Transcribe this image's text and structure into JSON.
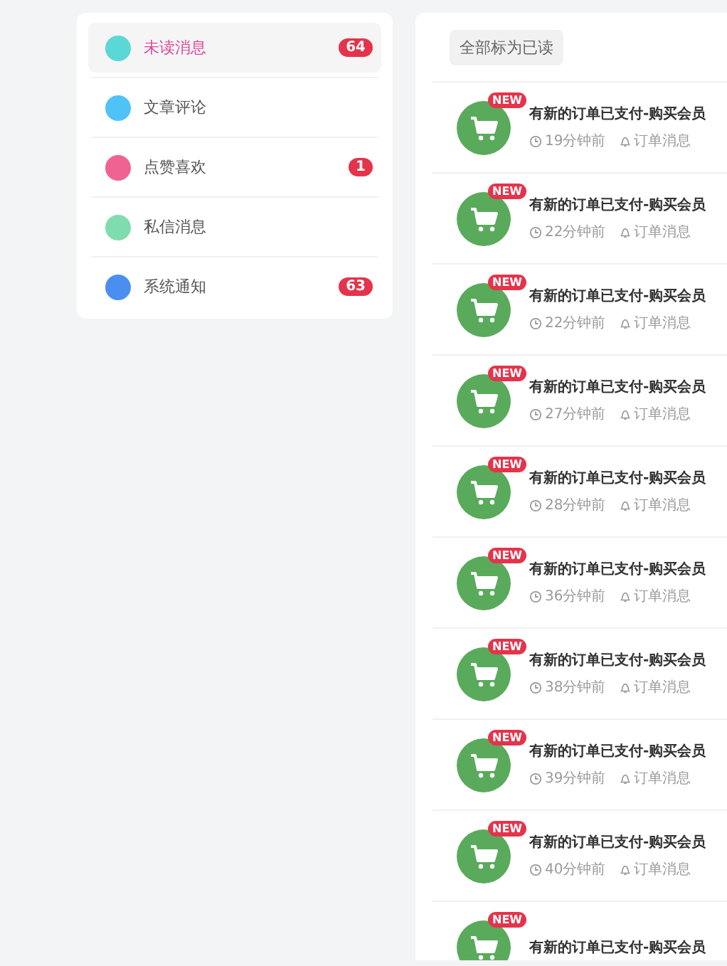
{
  "sidebar": {
    "items": [
      {
        "label": "未读消息",
        "selected": true,
        "color": "#5ad8d6",
        "badge": "64"
      },
      {
        "label": "文章评论",
        "selected": false,
        "color": "#4fc3f7"
      },
      {
        "label": "点赞喜欢",
        "selected": false,
        "color": "#f06292",
        "badge": "1"
      },
      {
        "label": "私信消息",
        "selected": false,
        "color": "#7fdcae"
      },
      {
        "label": "系统通知",
        "selected": false,
        "color": "#4a8ff0",
        "badge": "63"
      }
    ]
  },
  "main": {
    "mark_all_button": "全部标为已读",
    "messages": [
      {
        "badge": "NEW",
        "title": "有新的订单已支付-购买会员",
        "time": "19分钟前",
        "category": "订单消息"
      },
      {
        "badge": "NEW",
        "title": "有新的订单已支付-购买会员",
        "time": "22分钟前",
        "category": "订单消息"
      },
      {
        "badge": "NEW",
        "title": "有新的订单已支付-购买会员",
        "time": "22分钟前",
        "category": "订单消息"
      },
      {
        "badge": "NEW",
        "title": "有新的订单已支付-购买会员",
        "time": "27分钟前",
        "category": "订单消息"
      },
      {
        "badge": "NEW",
        "title": "有新的订单已支付-购买会员",
        "time": "28分钟前",
        "category": "订单消息"
      },
      {
        "badge": "NEW",
        "title": "有新的订单已支付-购买会员",
        "time": "36分钟前",
        "category": "订单消息"
      },
      {
        "badge": "NEW",
        "title": "有新的订单已支付-购买会员",
        "time": "38分钟前",
        "category": "订单消息"
      },
      {
        "badge": "NEW",
        "title": "有新的订单已支付-购买会员",
        "time": "39分钟前",
        "category": "订单消息"
      },
      {
        "badge": "NEW",
        "title": "有新的订单已支付-购买会员",
        "time": "40分钟前",
        "category": "订单消息"
      },
      {
        "badge": "NEW",
        "title": "有新的订单已支付-购买会员"
      }
    ]
  }
}
